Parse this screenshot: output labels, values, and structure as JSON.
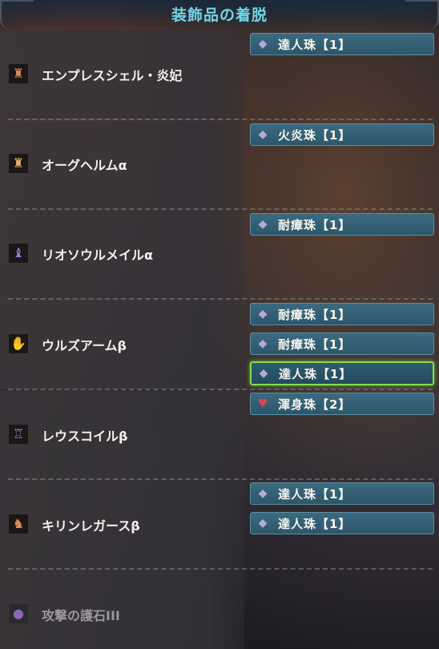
{
  "header": {
    "title": "装飾品の着脱"
  },
  "colors": {
    "title": "#6fd6e6",
    "slot_bg": "#2d566a",
    "selected_border": "#7ee04a",
    "gem_lv1": "#b8a8d8",
    "gem_lv2": "#e04050"
  },
  "equipment": [
    {
      "name": "エンプレスシェル・炎妃",
      "icon": "helm-icon",
      "decorations": [
        {
          "label": "達人珠【1】",
          "gem": "gem-lv1-icon"
        }
      ]
    },
    {
      "name": "オーグヘルムα",
      "icon": "helm-icon",
      "decorations": [
        {
          "label": "火炎珠【1】",
          "gem": "gem-lv1-icon"
        }
      ]
    },
    {
      "name": "リオソウルメイルα",
      "icon": "chest-icon",
      "decorations": [
        {
          "label": "耐瘴珠【1】",
          "gem": "gem-lv1-icon"
        }
      ]
    },
    {
      "name": "ウルズアームβ",
      "icon": "arm-icon",
      "decorations": [
        {
          "label": "耐瘴珠【1】",
          "gem": "gem-lv1-icon"
        },
        {
          "label": "耐瘴珠【1】",
          "gem": "gem-lv1-icon"
        },
        {
          "label": "達人珠【1】",
          "gem": "gem-lv1-icon",
          "selected": true
        }
      ]
    },
    {
      "name": "レウスコイルβ",
      "icon": "waist-icon",
      "decorations": [
        {
          "label": "渾身珠【2】",
          "gem": "gem-lv2-icon"
        }
      ]
    },
    {
      "name": "キリンレガースβ",
      "icon": "leg-icon",
      "decorations": [
        {
          "label": "達人珠【1】",
          "gem": "gem-lv1-icon"
        },
        {
          "label": "達人珠【1】",
          "gem": "gem-lv1-icon"
        }
      ]
    },
    {
      "name": "攻撃の護石III",
      "icon": "charm-icon",
      "decorations": []
    }
  ]
}
